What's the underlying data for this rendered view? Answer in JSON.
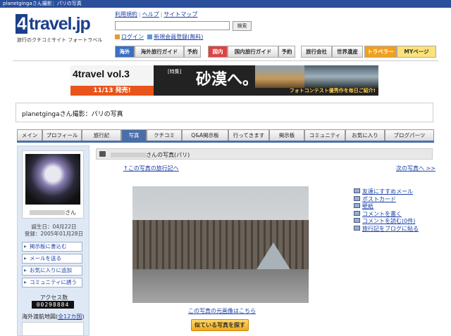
{
  "topbar": "planetgingaさん撮影：パリの写真",
  "logo": {
    "main": "travel.jp",
    "prefix": "4",
    "sub": "旅行のクチコミサイト フォートラベル"
  },
  "toplinks": [
    "利用規約",
    "ヘルプ",
    "サイトマップ"
  ],
  "search": {
    "button": "検索",
    "value": ""
  },
  "user_links": {
    "login": "ログイン",
    "register": "新規会員登録(無料)"
  },
  "nav": {
    "overseas": "海外",
    "overseas_guide": "海外旅行ガイド",
    "reserve1": "予約",
    "domestic": "国内",
    "domestic_guide": "国内旅行ガイド",
    "reserve2": "予約",
    "agency": "旅行会社",
    "heritage": "世界遺産",
    "traveler": "トラベラー",
    "mypage": "MYページ"
  },
  "banner": {
    "brand": "4travel vol.3",
    "launch": "11/13 発売!",
    "feature": "[特集]",
    "title": "砂漠へ。",
    "sub": "フォトコンテスト優秀作を毎日ご紹介!"
  },
  "page_title": "planetgingaさん撮影：パリの写真",
  "user_tabs": [
    "メイン",
    "プロフィール",
    "旅行記",
    "写真",
    "クチコミ",
    "Q&A掲示板",
    "行ってきます",
    "掲示板",
    "コミュニティ",
    "お気に入り",
    "ブログパーツ"
  ],
  "sidebar": {
    "name_suffix": "さん",
    "birthday": "誕生日：04月22日",
    "registered": "登録：2005年01月28日",
    "buttons": [
      "掲示板に書込む",
      "メールを送る",
      "お気に入りに追加",
      "コミュニティに誘う"
    ],
    "access_label": "アクセス数",
    "access_count": "00298884",
    "map_label": "海外渡航地図",
    "map_count": "全12カ国"
  },
  "content": {
    "head_suffix": "さんの写真(パリ)",
    "trip_link": "↑この写真の旅行記へ",
    "next_link": "次の写真へ >>",
    "orig_link": "この写真の元画像はこちら",
    "similar": "似ている写真を探す"
  },
  "rlinks": [
    "友達にすすめメール",
    "ポストカード",
    "壁紙",
    "コメントを書く",
    "コメントを読む(0件)",
    "旅行記をブログに貼る"
  ]
}
